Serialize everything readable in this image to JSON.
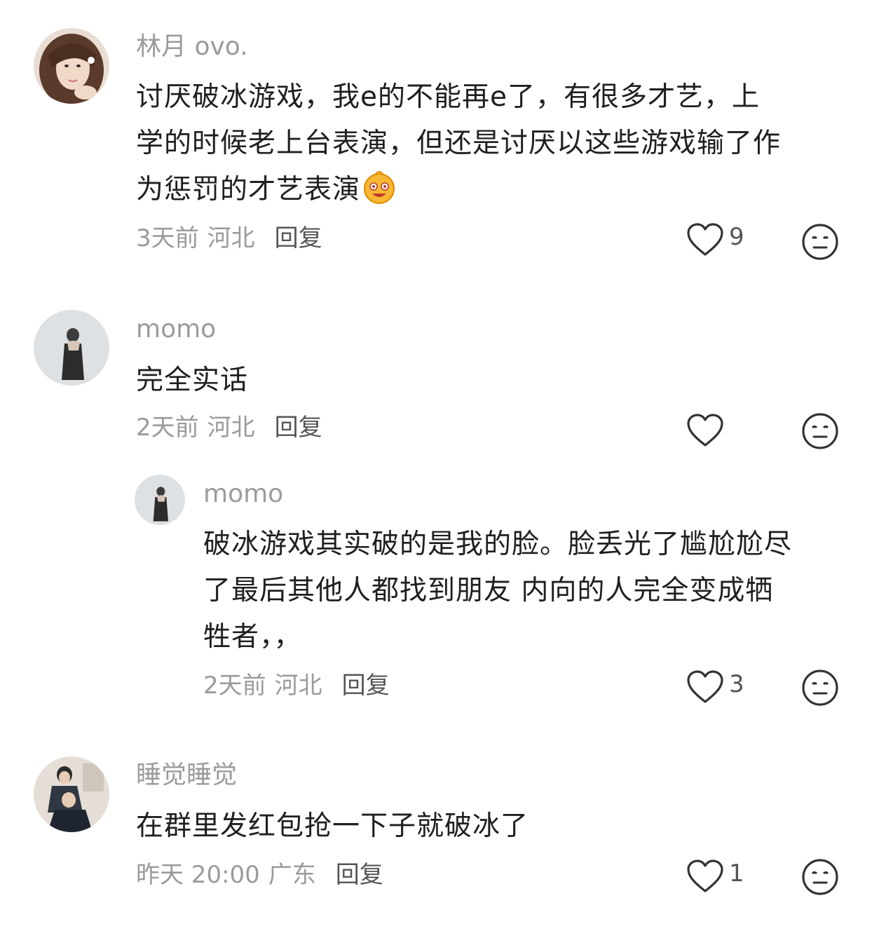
{
  "comments": [
    {
      "username": "林月 ovo.",
      "lines": [
        "讨厌破冰游戏，我e的不能再e了，有很多才艺，上",
        "学的时候老上台表演，但还是讨厌以这些游戏输了作",
        "为惩罚的才艺表演"
      ],
      "time": "3天前",
      "location": "河北",
      "reply_label": "回复",
      "likes": "9",
      "avatar_icon": "avatar-girl-portrait",
      "emoji_icon": "smiling-face-emoji"
    },
    {
      "username": "momo",
      "lines": [
        "完全实话"
      ],
      "time": "2天前",
      "location": "河北",
      "reply_label": "回复",
      "likes": "",
      "avatar_icon": "avatar-standing-figure"
    },
    {
      "username": "momo",
      "lines": [
        "破冰游戏其实破的是我的脸。脸丢光了尴尬尬尽",
        "了最后其他人都找到朋友 内向的人完全变成牺",
        "牲者，，"
      ],
      "time": "2天前",
      "location": "河北",
      "reply_label": "回复",
      "likes": "3",
      "avatar_icon": "avatar-standing-figure"
    },
    {
      "username": "睡觉睡觉",
      "lines": [
        "在群里发红包抢一下子就破冰了"
      ],
      "time": "昨天 20:00",
      "location": "广东",
      "reply_label": "回复",
      "likes": "1",
      "avatar_icon": "avatar-two-people"
    }
  ],
  "colors": {
    "username": "#9b9b9b",
    "content": "#1f1f1f",
    "meta": "#9b9b9b",
    "reply": "#555555",
    "icon_stroke": "#333333"
  }
}
